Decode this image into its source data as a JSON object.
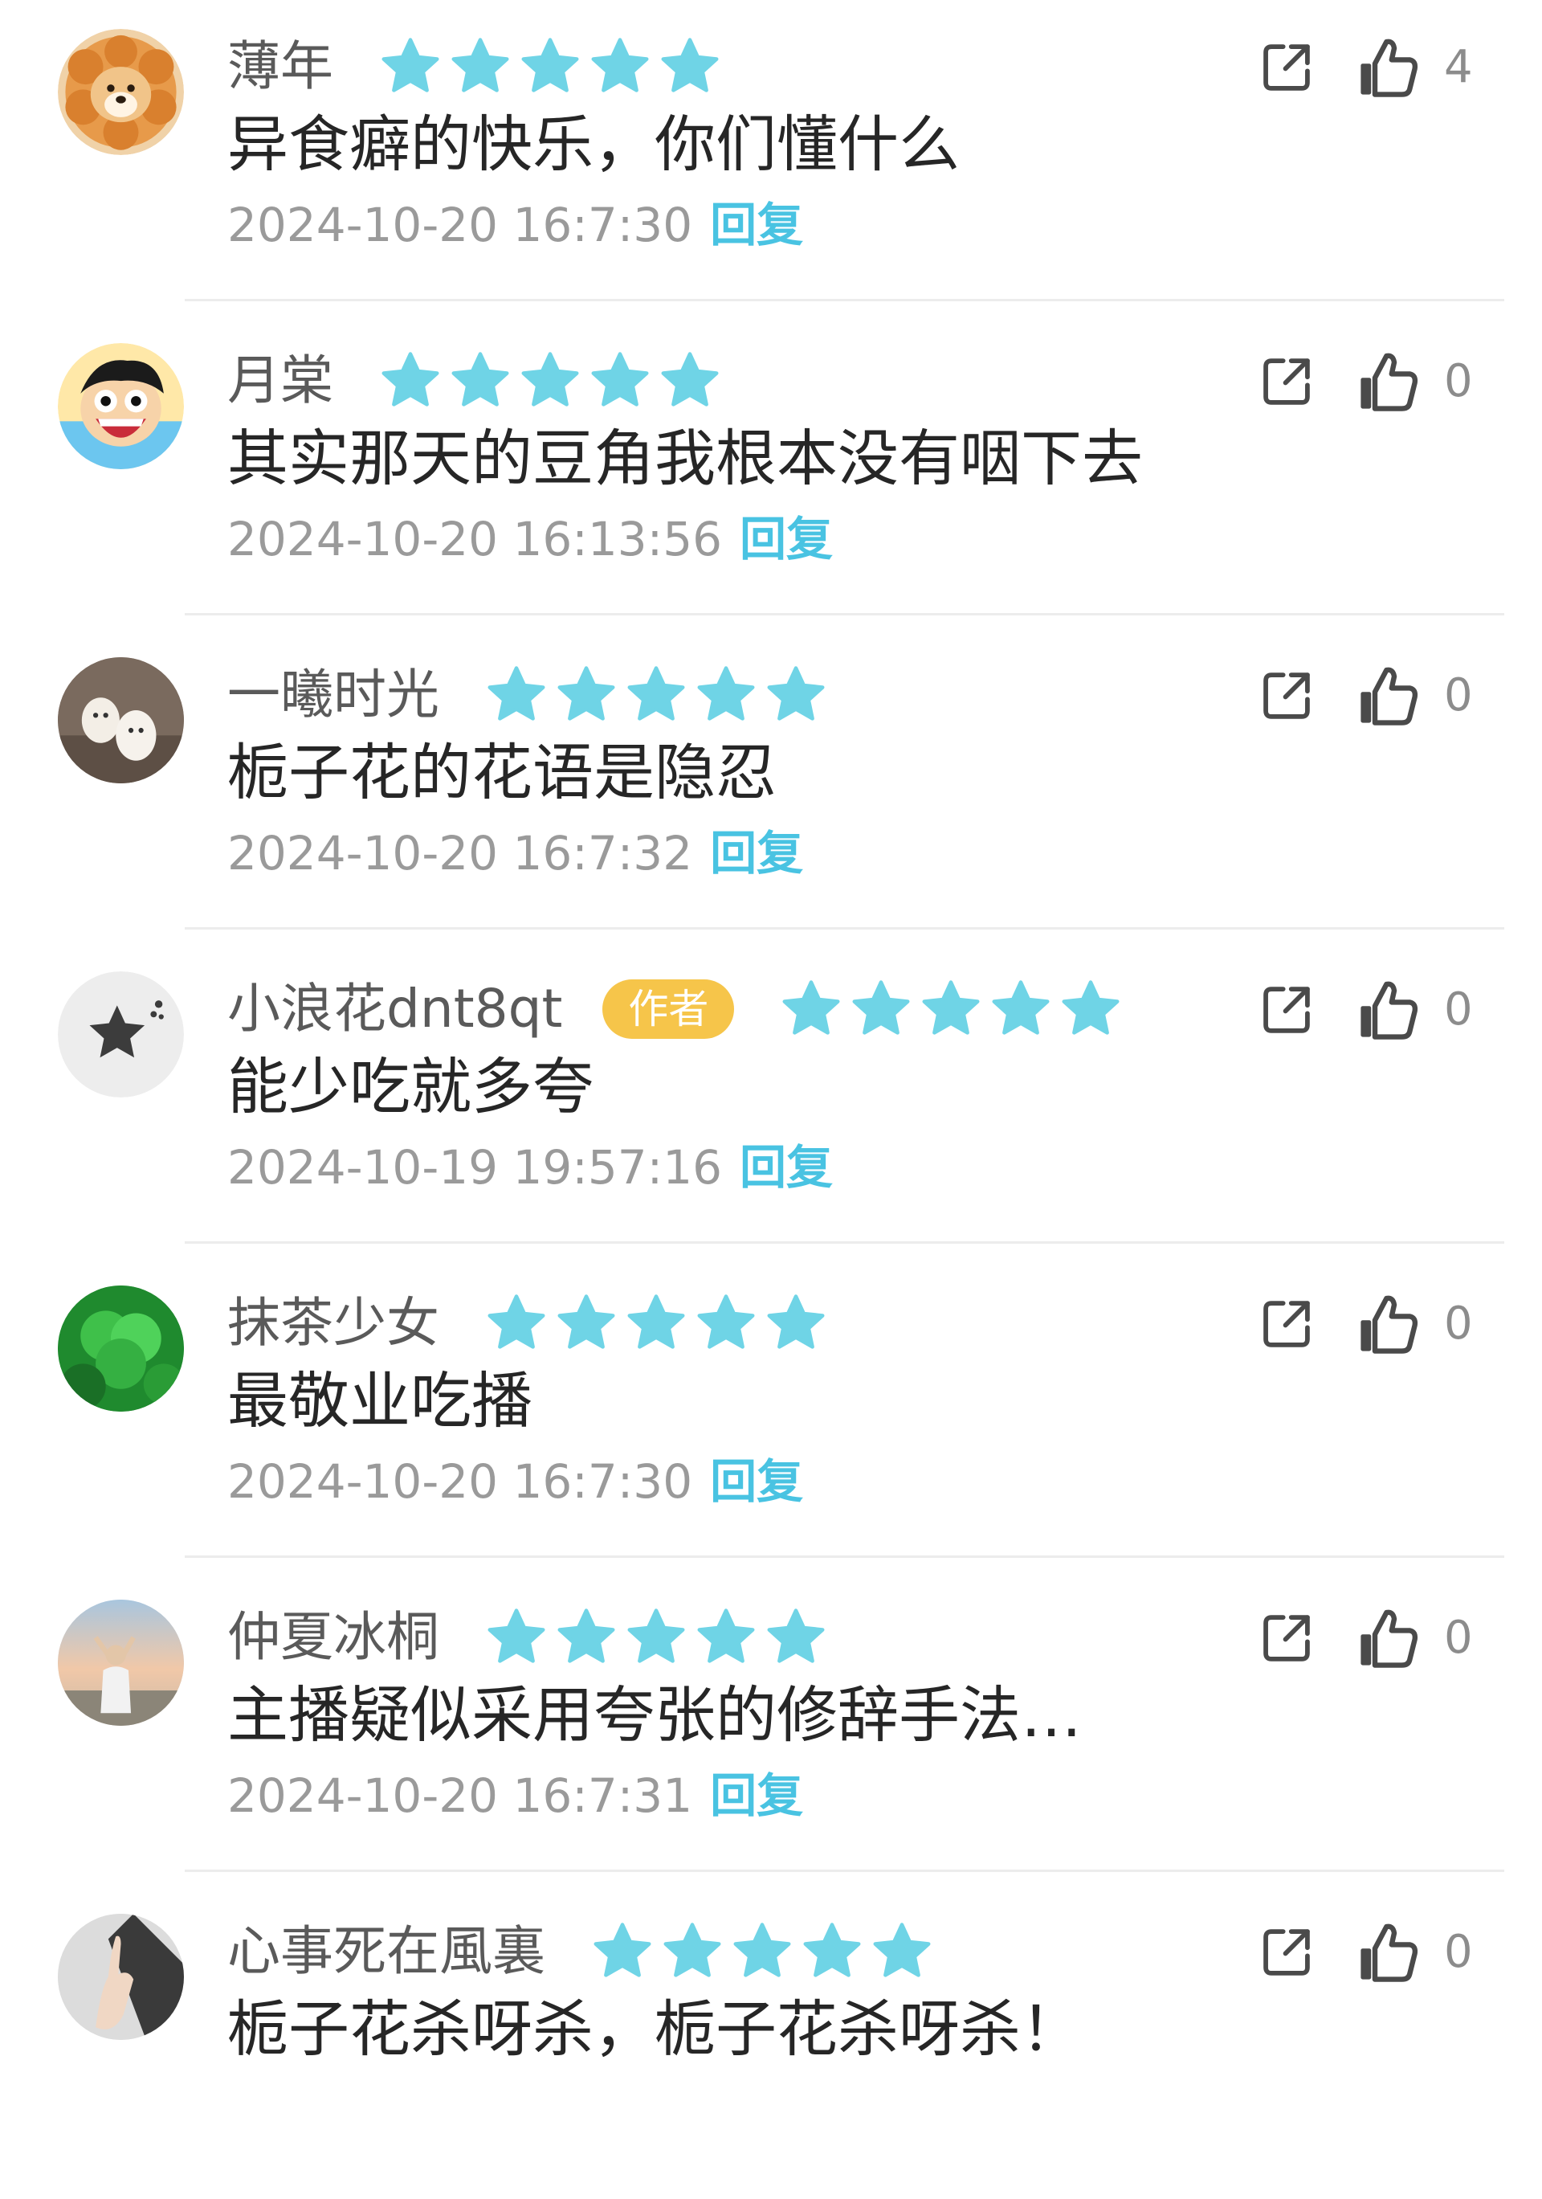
{
  "theme": {
    "accent": "#49c3e2",
    "star_color": "#6fd4e6",
    "badge_color": "#f6c54a",
    "text_muted": "#9a9a9a",
    "icon_color": "#4a4a4a"
  },
  "comments": [
    {
      "username": "薄年",
      "is_author": false,
      "rating": 5,
      "text": "异食癖的快乐，你们懂什么",
      "timestamp": "2024-10-20 16:7:30",
      "reply_label": "回复",
      "like_count": "4",
      "avatar": "shiba-dog-avatar"
    },
    {
      "username": "月棠",
      "is_author": false,
      "rating": 5,
      "text": "其实那天的豆角我根本没有咽下去",
      "timestamp": "2024-10-20 16:13:56",
      "reply_label": "回复",
      "like_count": "0",
      "avatar": "cartoon-pirate-avatar"
    },
    {
      "username": "一曦时光",
      "is_author": false,
      "rating": 5,
      "text": "栀子花的花语是隐忍",
      "timestamp": "2024-10-20 16:7:32",
      "reply_label": "回复",
      "like_count": "0",
      "avatar": "white-puppies-avatar"
    },
    {
      "username": "小浪花dnt8qt",
      "is_author": true,
      "author_label": "作者",
      "rating": 5,
      "text": "能少吃就多夸",
      "timestamp": "2024-10-19 19:57:16",
      "reply_label": "回复",
      "like_count": "0",
      "avatar": "default-star-avatar"
    },
    {
      "username": "抹茶少女",
      "is_author": false,
      "rating": 5,
      "text": "最敬业吃播",
      "timestamp": "2024-10-20 16:7:30",
      "reply_label": "回复",
      "like_count": "0",
      "avatar": "clover-leaf-avatar"
    },
    {
      "username": "仲夏冰桐",
      "is_author": false,
      "rating": 5,
      "text": "主播疑似采用夸张的修辞手法…",
      "timestamp": "2024-10-20 16:7:31",
      "reply_label": "回复",
      "like_count": "0",
      "avatar": "sunset-portrait-avatar"
    },
    {
      "username": "心事死在風裏",
      "is_author": false,
      "rating": 5,
      "text": "栀子花杀呀杀，栀子花杀呀杀！",
      "timestamp": "",
      "reply_label": "",
      "like_count": "0",
      "avatar": "hand-gesture-avatar"
    }
  ]
}
